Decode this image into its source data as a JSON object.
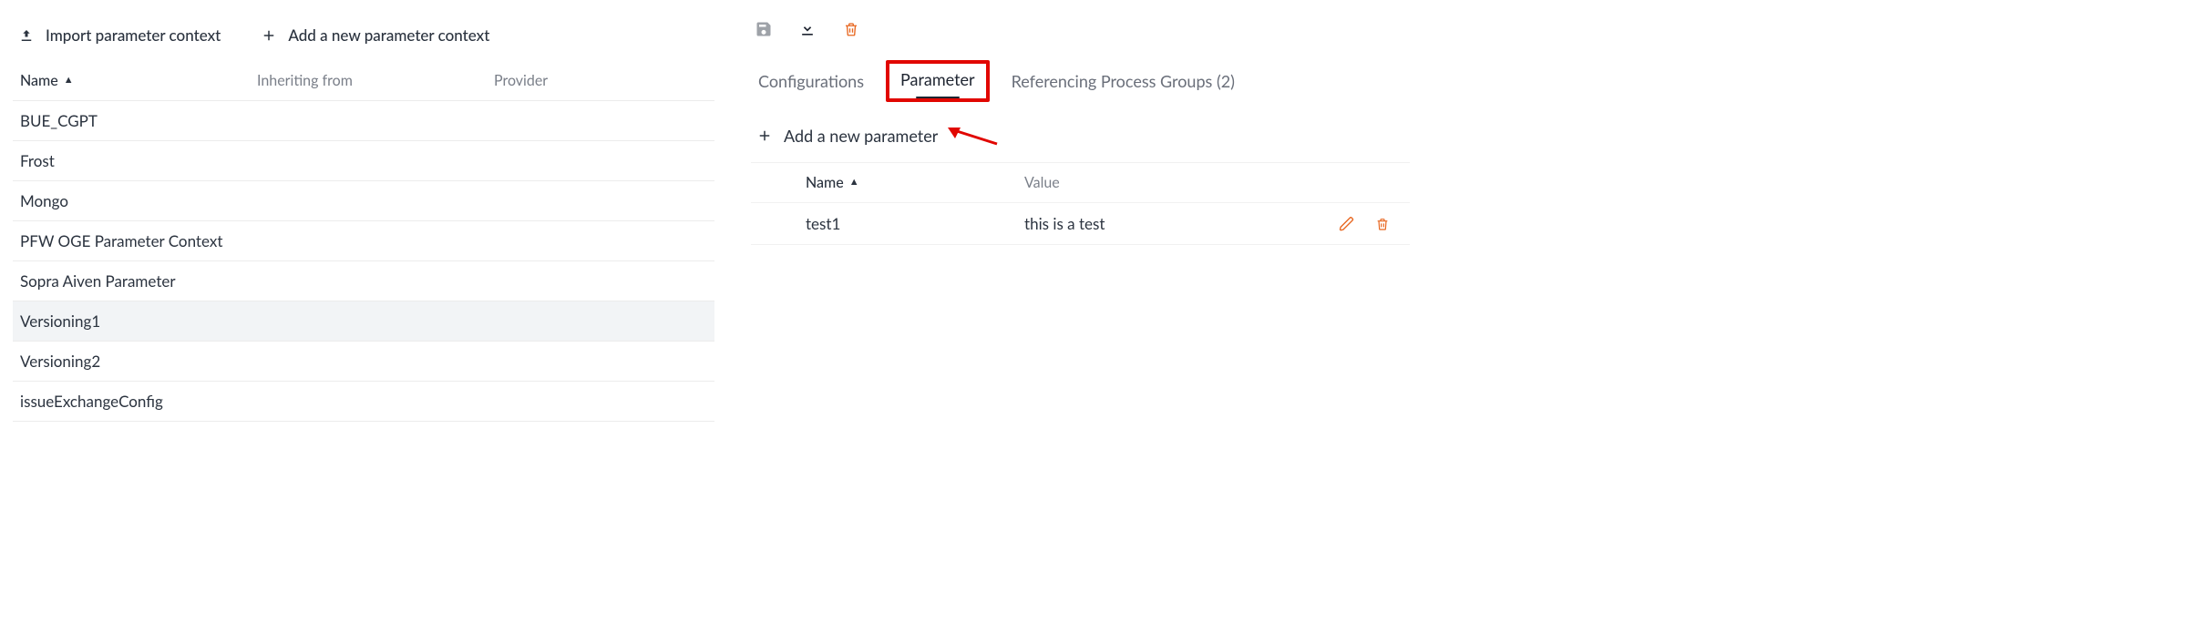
{
  "left": {
    "import_label": "Import parameter context",
    "add_label": "Add a new parameter context",
    "columns": {
      "name": "Name",
      "inheriting": "Inheriting from",
      "provider": "Provider"
    },
    "rows": [
      {
        "name": "BUE_CGPT"
      },
      {
        "name": "Frost"
      },
      {
        "name": "Mongo"
      },
      {
        "name": "PFW OGE Parameter Context"
      },
      {
        "name": "Sopra Aiven Parameter"
      },
      {
        "name": "Versioning1",
        "selected": true
      },
      {
        "name": "Versioning2"
      },
      {
        "name": "issueExchangeConfig"
      }
    ]
  },
  "right": {
    "toolbar_icons": [
      "save",
      "download",
      "delete"
    ],
    "tabs": {
      "configurations": "Configurations",
      "parameter": "Parameter",
      "referencing": "Referencing Process Groups (2)"
    },
    "active_tab": "parameter",
    "add_param_label": "Add a new parameter",
    "table": {
      "columns": {
        "name": "Name",
        "value": "Value"
      },
      "rows": [
        {
          "name": "test1",
          "value": "this is a test"
        }
      ]
    }
  },
  "colors": {
    "danger": "#e8661f",
    "ink": "#2b333f",
    "muted": "#7a7f89",
    "edit": "#e8661f"
  }
}
